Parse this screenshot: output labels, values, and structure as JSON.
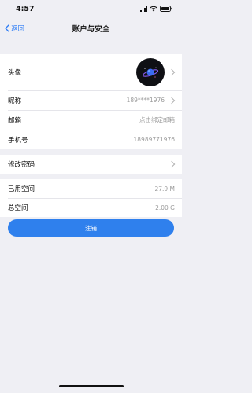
{
  "status_bar": {
    "time": "4:57"
  },
  "nav": {
    "back_label": "返回",
    "title": "账户与安全"
  },
  "profile": {
    "avatar_label": "头像",
    "nickname_label": "昵称",
    "nickname_value": "189****1976",
    "email_label": "邮箱",
    "email_value": "点击绑定邮箱",
    "phone_label": "手机号",
    "phone_value": "18989771976"
  },
  "security": {
    "change_password_label": "修改密码"
  },
  "storage": {
    "used_label": "已用空间",
    "used_value": "27.9 M",
    "total_label": "总空间",
    "total_value": "2.00 G"
  },
  "actions": {
    "logout_label": "注销"
  },
  "colors": {
    "accent": "#2f80ed",
    "background": "#efeff4"
  }
}
